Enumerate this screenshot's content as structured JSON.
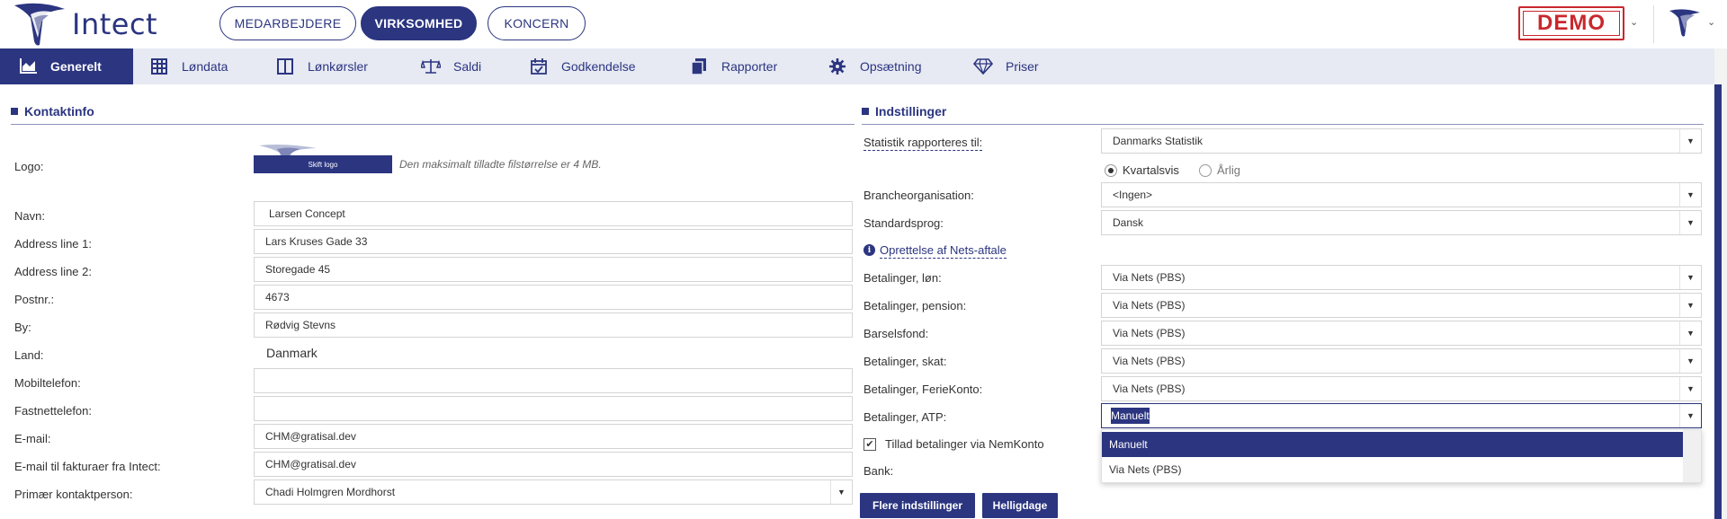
{
  "header": {
    "brand": "Intect",
    "tabs": [
      {
        "label": "MEDARBEJDERE",
        "active": false
      },
      {
        "label": "VIRKSOMHED",
        "active": true
      },
      {
        "label": "KONCERN",
        "active": false
      }
    ],
    "demo_badge": "DEMO"
  },
  "nav": {
    "items": [
      {
        "label": "Generelt",
        "icon": "chart-icon",
        "active": true
      },
      {
        "label": "Løndata",
        "icon": "table-icon",
        "active": false
      },
      {
        "label": "Lønkørsler",
        "icon": "columns-icon",
        "active": false
      },
      {
        "label": "Saldi",
        "icon": "scale-icon",
        "active": false
      },
      {
        "label": "Godkendelse",
        "icon": "calendar-check-icon",
        "active": false
      },
      {
        "label": "Rapporter",
        "icon": "files-icon",
        "active": false
      },
      {
        "label": "Opsætning",
        "icon": "gear-icon",
        "active": false
      },
      {
        "label": "Priser",
        "icon": "diamond-icon",
        "active": false
      }
    ]
  },
  "contact": {
    "title": "Kontaktinfo",
    "logo_label": "Logo:",
    "change_logo_button": "Skift logo",
    "logo_hint": "Den maksimalt tilladte filstørrelse er 4 MB.",
    "fields": [
      {
        "label": "Navn:",
        "value": "Larsen Concept"
      },
      {
        "label": "Address line 1:",
        "value": "Lars Kruses Gade 33"
      },
      {
        "label": "Address line 2:",
        "value": "Storegade 45"
      },
      {
        "label": "Postnr.:",
        "value": "4673"
      },
      {
        "label": "By:",
        "value": "Rødvig Stevns"
      },
      {
        "label": "Land:",
        "value": "Danmark"
      },
      {
        "label": "Mobiltelefon:",
        "value": ""
      },
      {
        "label": "Fastnettelefon:",
        "value": ""
      },
      {
        "label": "E-mail:",
        "value": "CHM@gratisal.dev"
      },
      {
        "label": "E-mail til fakturaer fra Intect:",
        "value": "CHM@gratisal.dev"
      },
      {
        "label": "Primær kontaktperson:",
        "value": "Chadi Holmgren Mordhorst"
      }
    ]
  },
  "settings": {
    "title": "Indstillinger",
    "statistik_label": "Statistik rapporteres til:",
    "statistik_value": "Danmarks Statistik",
    "radio_quarterly": "Kvartalsvis",
    "radio_yearly": "Årlig",
    "branche_label": "Brancheorganisation:",
    "branche_value": "<Ingen>",
    "sprog_label": "Standardsprog:",
    "sprog_value": "Dansk",
    "nets_link": "Oprettelse af Nets-aftale",
    "payments": [
      {
        "label": "Betalinger, løn:",
        "value": "Via Nets (PBS)"
      },
      {
        "label": "Betalinger, pension:",
        "value": "Via Nets (PBS)"
      },
      {
        "label": "Barselsfond:",
        "value": "Via Nets (PBS)"
      },
      {
        "label": "Betalinger, skat:",
        "value": "Via Nets (PBS)"
      },
      {
        "label": "Betalinger, FerieKonto:",
        "value": "Via Nets (PBS)"
      }
    ],
    "atp_label": "Betalinger, ATP:",
    "atp_value": "Manuelt",
    "atp_options": [
      "Manuelt",
      "Via Nets (PBS)"
    ],
    "nemkonto_label": "Tillad betalinger via NemKonto",
    "bank_label": "Bank:",
    "more_button": "Flere indstillinger",
    "holidays_button": "Helligdage"
  }
}
